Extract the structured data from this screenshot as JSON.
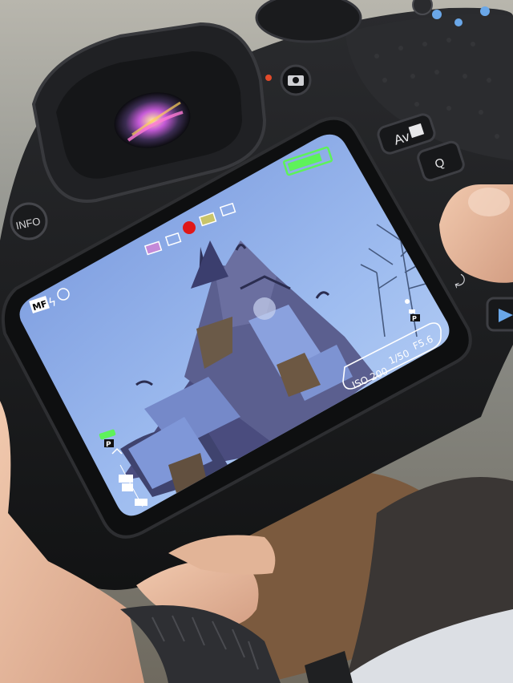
{
  "camera": {
    "body_buttons": {
      "info": "INFO",
      "av": "Av",
      "q": "Q"
    }
  },
  "viewfinder": {
    "focus_mode": "MF",
    "drive_mode": "P",
    "shooting_mode": "P",
    "iso": "ISO 200",
    "shutter": "1/50",
    "aperture": "F5.6",
    "battery_level": 1.0,
    "recording_color": "#e01818"
  },
  "colors": {
    "sky": "#7fa3e6",
    "body": "#1d1e20",
    "accent_blue": "#6aa7e8",
    "battery_green": "#4fe04a"
  }
}
